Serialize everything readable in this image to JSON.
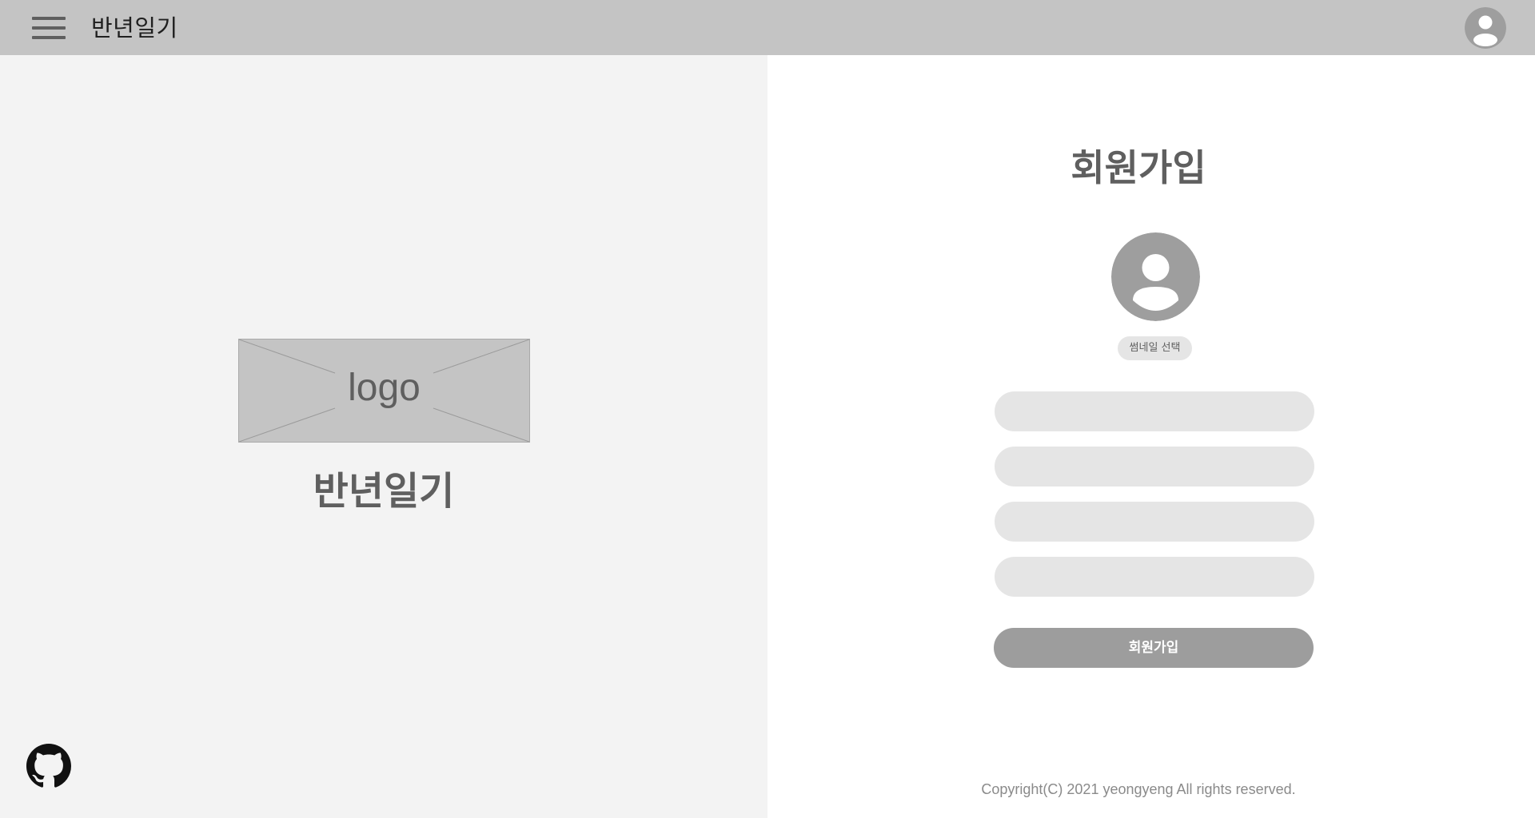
{
  "header": {
    "menu_icon": "hamburger-menu-icon",
    "title": "반년일기",
    "profile_icon": "user-avatar-icon"
  },
  "left": {
    "logo_text": "logo",
    "brand_name": "반년일기",
    "github_icon": "github-icon"
  },
  "signup": {
    "heading": "회원가입",
    "avatar_icon": "user-avatar-icon",
    "thumbnail_button": "썸네일 선택",
    "fields": [
      {
        "value": "",
        "placeholder": ""
      },
      {
        "value": "",
        "placeholder": ""
      },
      {
        "value": "",
        "placeholder": ""
      },
      {
        "value": "",
        "placeholder": ""
      }
    ],
    "submit_label": "회원가입"
  },
  "footer": {
    "copyright": "Copyright(C) 2021 yeongyeng All rights reserved."
  },
  "colors": {
    "topbar": "#c4c4c4",
    "left_panel": "#f3f3f3",
    "heading_text": "#5f5f5f",
    "input_bg": "#e5e5e5",
    "button_bg": "#9d9d9d",
    "avatar_bg": "#9e9e9e"
  }
}
